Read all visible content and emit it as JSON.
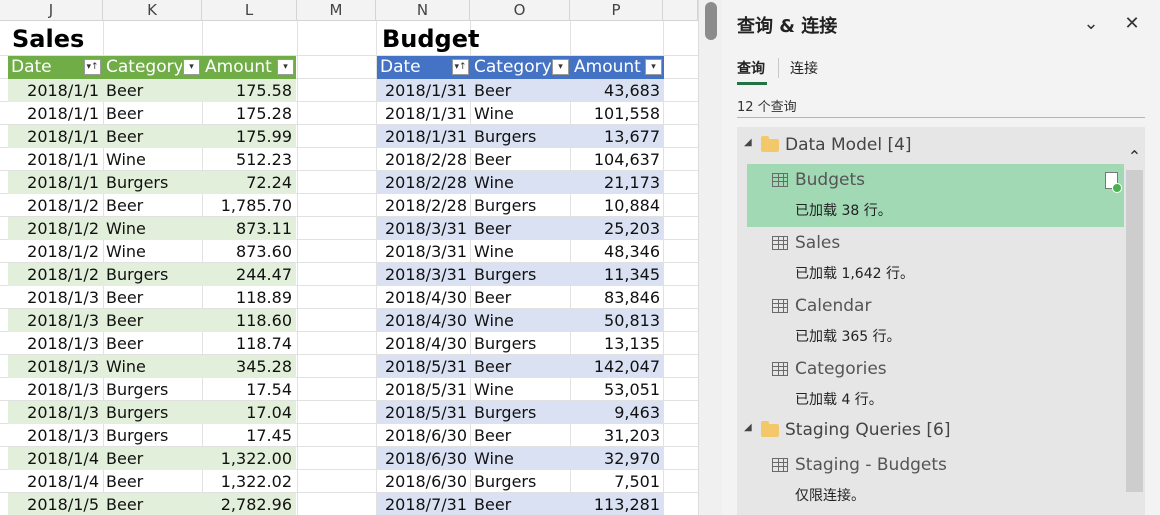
{
  "columns": [
    "J",
    "K",
    "L",
    "M",
    "N",
    "O",
    "P"
  ],
  "sales": {
    "title": "Sales",
    "headers": [
      "Date",
      "Category",
      "Amount"
    ],
    "rows": [
      [
        "2018/1/1",
        "Beer",
        "175.58"
      ],
      [
        "2018/1/1",
        "Beer",
        "175.28"
      ],
      [
        "2018/1/1",
        "Beer",
        "175.99"
      ],
      [
        "2018/1/1",
        "Wine",
        "512.23"
      ],
      [
        "2018/1/1",
        "Burgers",
        "72.24"
      ],
      [
        "2018/1/2",
        "Beer",
        "1,785.70"
      ],
      [
        "2018/1/2",
        "Wine",
        "873.11"
      ],
      [
        "2018/1/2",
        "Wine",
        "873.60"
      ],
      [
        "2018/1/2",
        "Burgers",
        "244.47"
      ],
      [
        "2018/1/3",
        "Beer",
        "118.89"
      ],
      [
        "2018/1/3",
        "Beer",
        "118.60"
      ],
      [
        "2018/1/3",
        "Beer",
        "118.74"
      ],
      [
        "2018/1/3",
        "Wine",
        "345.28"
      ],
      [
        "2018/1/3",
        "Burgers",
        "17.54"
      ],
      [
        "2018/1/3",
        "Burgers",
        "17.04"
      ],
      [
        "2018/1/3",
        "Burgers",
        "17.45"
      ],
      [
        "2018/1/4",
        "Beer",
        "1,322.00"
      ],
      [
        "2018/1/4",
        "Beer",
        "1,322.02"
      ],
      [
        "2018/1/5",
        "Beer",
        "2,782.96"
      ]
    ]
  },
  "budget": {
    "title": "Budget",
    "headers": [
      "Date",
      "Category",
      "Amount"
    ],
    "rows": [
      [
        "2018/1/31",
        "Beer",
        "43,683"
      ],
      [
        "2018/1/31",
        "Wine",
        "101,558"
      ],
      [
        "2018/1/31",
        "Burgers",
        "13,677"
      ],
      [
        "2018/2/28",
        "Beer",
        "104,637"
      ],
      [
        "2018/2/28",
        "Wine",
        "21,173"
      ],
      [
        "2018/2/28",
        "Burgers",
        "10,884"
      ],
      [
        "2018/3/31",
        "Beer",
        "25,203"
      ],
      [
        "2018/3/31",
        "Wine",
        "48,346"
      ],
      [
        "2018/3/31",
        "Burgers",
        "11,345"
      ],
      [
        "2018/4/30",
        "Beer",
        "83,846"
      ],
      [
        "2018/4/30",
        "Wine",
        "50,813"
      ],
      [
        "2018/4/30",
        "Burgers",
        "13,135"
      ],
      [
        "2018/5/31",
        "Beer",
        "142,047"
      ],
      [
        "2018/5/31",
        "Wine",
        "53,051"
      ],
      [
        "2018/5/31",
        "Burgers",
        "9,463"
      ],
      [
        "2018/6/30",
        "Beer",
        "31,203"
      ],
      [
        "2018/6/30",
        "Wine",
        "32,970"
      ],
      [
        "2018/6/30",
        "Burgers",
        "7,501"
      ],
      [
        "2018/7/31",
        "Beer",
        "113,281"
      ]
    ]
  },
  "pane": {
    "title": "查询 & 连接",
    "collapse_icon": "chevron-down-icon",
    "close_icon": "close-icon",
    "tabs": [
      "查询",
      "连接"
    ],
    "active_tab": "查询",
    "count_text": "12 个查询",
    "groups": [
      {
        "name": "Data Model",
        "count": "[4]",
        "queries": [
          {
            "name": "Budgets",
            "status": "已加载 38 行。",
            "selected": true
          },
          {
            "name": "Sales",
            "status": "已加载 1,642 行。",
            "selected": false
          },
          {
            "name": "Calendar",
            "status": "已加载 365 行。",
            "selected": false
          },
          {
            "name": "Categories",
            "status": "已加载 4 行。",
            "selected": false
          }
        ]
      },
      {
        "name": "Staging Queries",
        "count": "[6]",
        "queries": [
          {
            "name": "Staging - Budgets",
            "status": "仅限连接。",
            "selected": false
          }
        ]
      }
    ]
  },
  "colors": {
    "sales_header": "#70ad47",
    "sales_band": "#e2efda",
    "budget_header": "#4472c4",
    "budget_band": "#d9e1f2",
    "selected_query": "#a0d9b4"
  }
}
